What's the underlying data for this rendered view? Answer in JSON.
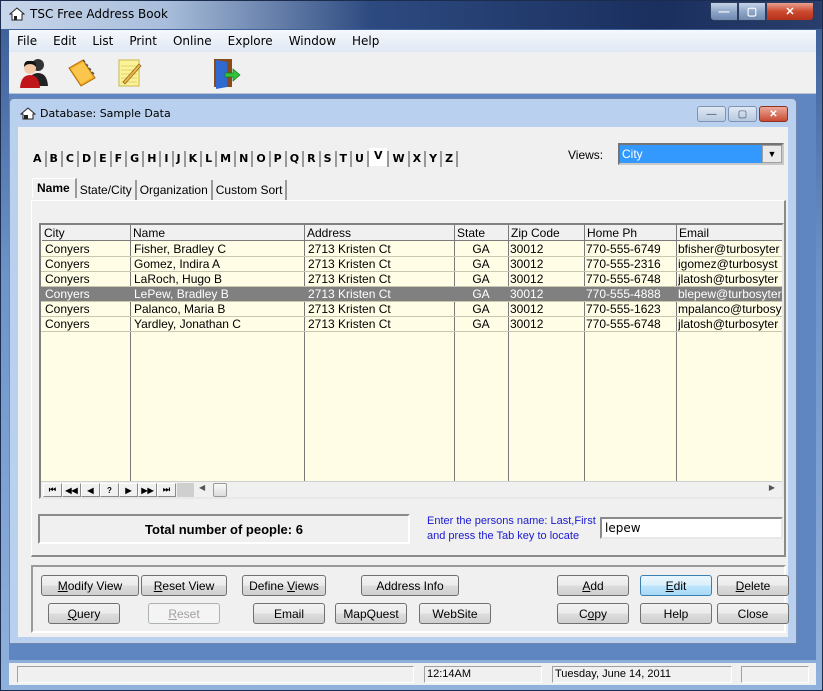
{
  "window": {
    "title": "TSC Free Address Book",
    "controls": {
      "minimize": "—",
      "maximize": "▢",
      "close": "✕"
    }
  },
  "menu": [
    "File",
    "Edit",
    "List",
    "Print",
    "Online",
    "Explore",
    "Window",
    "Help"
  ],
  "toolbar": {
    "icons": [
      "people-icon",
      "address-book-icon",
      "notepad-icon",
      "exit-door-icon"
    ]
  },
  "child_window": {
    "title": "Database: Sample Data",
    "controls": {
      "minimize": "—",
      "maximize": "▢",
      "close": "✕"
    }
  },
  "alphabet": [
    "A",
    "B",
    "C",
    "D",
    "E",
    "F",
    "G",
    "H",
    "I",
    "J",
    "K",
    "L",
    "M",
    "N",
    "O",
    "P",
    "Q",
    "R",
    "S",
    "T",
    "U",
    "V",
    "W",
    "X",
    "Y",
    "Z"
  ],
  "active_letter": "V",
  "views": {
    "label": "Views:",
    "selected": "City",
    "dropdown_glyph": "▼"
  },
  "tabs": [
    {
      "label": "Name",
      "active": true
    },
    {
      "label": "State/City",
      "active": false
    },
    {
      "label": "Organization",
      "active": false
    },
    {
      "label": "Custom Sort",
      "active": false
    }
  ],
  "grid": {
    "columns": [
      "City",
      "Name",
      "Address",
      "State",
      "Zip Code",
      "Home Ph",
      "Email"
    ],
    "rows": [
      {
        "city": "Conyers",
        "name": "Fisher, Bradley C",
        "address": "2713 Kristen Ct",
        "state": "GA",
        "zip": "30012",
        "phone": "770-555-6749",
        "email": "bfisher@turbosyter",
        "selected": false
      },
      {
        "city": "Conyers",
        "name": "Gomez, Indira A",
        "address": "2713 Kristen Ct",
        "state": "GA",
        "zip": "30012",
        "phone": "770-555-2316",
        "email": "igomez@turbosyst",
        "selected": false
      },
      {
        "city": "Conyers",
        "name": "LaRoch, Hugo B",
        "address": "2713 Kristen Ct",
        "state": "GA",
        "zip": "30012",
        "phone": "770-555-6748",
        "email": "jlatosh@turbosyter",
        "selected": false
      },
      {
        "city": "Conyers",
        "name": "LePew, Bradley B",
        "address": "2713 Kristen Ct",
        "state": "GA",
        "zip": "30012",
        "phone": "770-555-4888",
        "email": "blepew@turbosyter",
        "selected": true
      },
      {
        "city": "Conyers",
        "name": "Palanco, Maria B",
        "address": "2713 Kristen Ct",
        "state": "GA",
        "zip": "30012",
        "phone": "770-555-1623",
        "email": "mpalanco@turbosy",
        "selected": false
      },
      {
        "city": "Conyers",
        "name": "Yardley, Jonathan C",
        "address": "2713 Kristen Ct",
        "state": "GA",
        "zip": "30012",
        "phone": "770-555-6748",
        "email": "jlatosh@turbosyter",
        "selected": false
      }
    ],
    "nav_buttons": [
      "⏮",
      "◀◀",
      "◀",
      "?",
      "▶",
      "▶▶",
      "⏭"
    ],
    "nav_names": [
      "first-record-button",
      "prev-page-button",
      "prev-record-button",
      "find-record-button",
      "next-record-button",
      "next-page-button",
      "last-record-button"
    ]
  },
  "total": {
    "text": "Total number of people: 6",
    "count": 6
  },
  "locate": {
    "hint_line1": "Enter the persons name: Last,First",
    "hint_line2": "and press the Tab key to locate",
    "value": "lepew"
  },
  "buttons": {
    "modify_view": {
      "pre": "",
      "u": "M",
      "post": "odify View"
    },
    "reset_view": {
      "pre": "",
      "u": "R",
      "post": "eset View"
    },
    "define_views": {
      "pre": "Define ",
      "u": "V",
      "post": "iews"
    },
    "address_info": {
      "pre": "Address Info",
      "u": "",
      "post": ""
    },
    "add": {
      "pre": "",
      "u": "A",
      "post": "dd"
    },
    "edit": {
      "pre": "",
      "u": "E",
      "post": "dit"
    },
    "delete": {
      "pre": "",
      "u": "D",
      "post": "elete"
    },
    "query": {
      "pre": "",
      "u": "Q",
      "post": "uery"
    },
    "reset": {
      "pre": "",
      "u": "R",
      "post": "eset"
    },
    "email": {
      "pre": "Email",
      "u": "",
      "post": ""
    },
    "mapquest": {
      "pre": "MapQuest",
      "u": "",
      "post": ""
    },
    "website": {
      "pre": "WebSite",
      "u": "",
      "post": ""
    },
    "copy": {
      "pre": "C",
      "u": "o",
      "post": "py"
    },
    "help": {
      "pre": "Help",
      "u": "",
      "post": ""
    },
    "close": {
      "pre": "Close",
      "u": "",
      "post": ""
    }
  },
  "statusbar": {
    "pane1": "",
    "time": "12:14AM",
    "date": "Tuesday, June 14, 2011",
    "pane4": ""
  }
}
